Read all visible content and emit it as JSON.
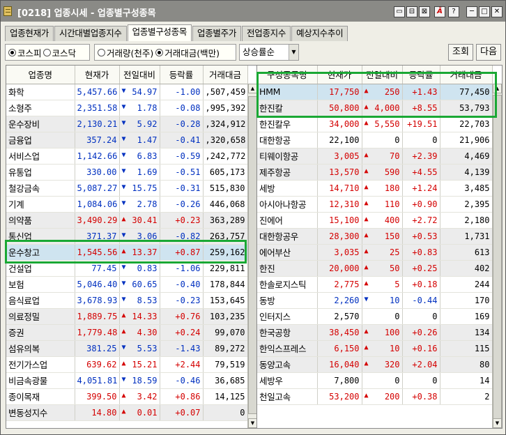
{
  "window": {
    "title": "[0218] 업종시세 - 업종별구성종목",
    "controls": [
      "▭",
      "⊟",
      "⊠",
      "Ā",
      "?",
      "─",
      "□",
      "✕"
    ]
  },
  "tabs": [
    "업종현재가",
    "시간대별업종지수",
    "업종별구성종목",
    "업종별주가",
    "전업종지수",
    "예상지수추이"
  ],
  "active_tab": "업종별구성종목",
  "filters": {
    "market_options": [
      "코스피",
      "코스닥"
    ],
    "market_selected": "코스피",
    "unit_options": [
      "거래량(천주)",
      "거래대금(백만)"
    ],
    "unit_selected": "거래대금(백만)",
    "sort_select": "상승률순",
    "query_button": "조회",
    "next_button": "다음"
  },
  "left_table": {
    "headers": [
      "업종명",
      "현재가",
      "전일대비",
      "등락률",
      "거래대금"
    ],
    "rows": [
      {
        "name": "화학",
        "price": "5,457.66",
        "dir": "down",
        "chg": "54.97",
        "rate": "-1.00",
        "amt": ",507,459"
      },
      {
        "name": "소형주",
        "price": "2,351.58",
        "dir": "down",
        "chg": "1.78",
        "rate": "-0.08",
        "amt": ",995,392"
      },
      {
        "name": "운수장비",
        "price": "2,130.21",
        "dir": "down",
        "chg": "5.92",
        "rate": "-0.28",
        "amt": ",324,912"
      },
      {
        "name": "금융업",
        "price": "357.24",
        "dir": "down",
        "chg": "1.47",
        "rate": "-0.41",
        "amt": ",320,658"
      },
      {
        "name": "서비스업",
        "price": "1,142.66",
        "dir": "down",
        "chg": "6.83",
        "rate": "-0.59",
        "amt": ",242,772"
      },
      {
        "name": "유통업",
        "price": "330.00",
        "dir": "down",
        "chg": "1.69",
        "rate": "-0.51",
        "amt": "605,173"
      },
      {
        "name": "철강금속",
        "price": "5,087.27",
        "dir": "down",
        "chg": "15.75",
        "rate": "-0.31",
        "amt": "515,830"
      },
      {
        "name": "기계",
        "price": "1,084.06",
        "dir": "down",
        "chg": "2.78",
        "rate": "-0.26",
        "amt": "446,068"
      },
      {
        "name": "의약품",
        "price": "3,490.29",
        "dir": "up",
        "chg": "30.41",
        "rate": "+0.23",
        "amt": "363,289"
      },
      {
        "name": "통신업",
        "price": "371.37",
        "dir": "down",
        "chg": "3.06",
        "rate": "-0.82",
        "amt": "263,757"
      },
      {
        "name": "운수창고",
        "price": "1,545.56",
        "dir": "up",
        "chg": "13.37",
        "rate": "+0.87",
        "amt": "259,162"
      },
      {
        "name": "건설업",
        "price": "77.45",
        "dir": "down",
        "chg": "0.83",
        "rate": "-1.06",
        "amt": "229,811"
      },
      {
        "name": "보험",
        "price": "5,046.40",
        "dir": "down",
        "chg": "60.65",
        "rate": "-0.40",
        "amt": "178,844"
      },
      {
        "name": "음식료업",
        "price": "3,678.93",
        "dir": "down",
        "chg": "8.53",
        "rate": "-0.23",
        "amt": "153,645"
      },
      {
        "name": "의료정밀",
        "price": "1,889.75",
        "dir": "up",
        "chg": "14.33",
        "rate": "+0.76",
        "amt": "103,235"
      },
      {
        "name": "증권",
        "price": "1,779.48",
        "dir": "up",
        "chg": "4.30",
        "rate": "+0.24",
        "amt": "99,070"
      },
      {
        "name": "섬유의복",
        "price": "381.25",
        "dir": "down",
        "chg": "5.53",
        "rate": "-1.43",
        "amt": "89,272"
      },
      {
        "name": "전기가스업",
        "price": "639.62",
        "dir": "up",
        "chg": "15.21",
        "rate": "+2.44",
        "amt": "79,519"
      },
      {
        "name": "비금속광물",
        "price": "4,051.81",
        "dir": "down",
        "chg": "18.59",
        "rate": "-0.46",
        "amt": "36,685"
      },
      {
        "name": "종이목재",
        "price": "399.50",
        "dir": "up",
        "chg": "3.42",
        "rate": "+0.86",
        "amt": "14,125"
      },
      {
        "name": "변동성지수",
        "price": "14.80",
        "dir": "up",
        "chg": "0.01",
        "rate": "+0.07",
        "amt": "0"
      }
    ]
  },
  "right_table": {
    "headers": [
      "구성종목명",
      "현재가",
      "전일대비",
      "등락률",
      "거래대금"
    ],
    "rows": [
      {
        "name": "HMM",
        "price": "17,750",
        "dir": "up",
        "chg": "250",
        "rate": "+1.43",
        "amt": "77,450"
      },
      {
        "name": "한진칼",
        "price": "50,800",
        "dir": "up",
        "chg": "4,000",
        "rate": "+8.55",
        "amt": "53,793"
      },
      {
        "name": "한진칼우",
        "price": "34,000",
        "dir": "up",
        "chg": "5,550",
        "rate": "+19.51",
        "amt": "22,703"
      },
      {
        "name": "대한항공",
        "price": "22,100",
        "dir": "flat",
        "chg": "0",
        "rate": "0",
        "amt": "21,906"
      },
      {
        "name": "티웨이항공",
        "price": "3,005",
        "dir": "up",
        "chg": "70",
        "rate": "+2.39",
        "amt": "4,469"
      },
      {
        "name": "제주항공",
        "price": "13,570",
        "dir": "up",
        "chg": "590",
        "rate": "+4.55",
        "amt": "4,139"
      },
      {
        "name": "세방",
        "price": "14,710",
        "dir": "up",
        "chg": "180",
        "rate": "+1.24",
        "amt": "3,485"
      },
      {
        "name": "아시아나항공",
        "price": "12,310",
        "dir": "up",
        "chg": "110",
        "rate": "+0.90",
        "amt": "2,395"
      },
      {
        "name": "진에어",
        "price": "15,100",
        "dir": "up",
        "chg": "400",
        "rate": "+2.72",
        "amt": "2,180"
      },
      {
        "name": "대한항공우",
        "price": "28,300",
        "dir": "up",
        "chg": "150",
        "rate": "+0.53",
        "amt": "1,731"
      },
      {
        "name": "에어부산",
        "price": "3,035",
        "dir": "up",
        "chg": "25",
        "rate": "+0.83",
        "amt": "613"
      },
      {
        "name": "한진",
        "price": "20,000",
        "dir": "up",
        "chg": "50",
        "rate": "+0.25",
        "amt": "402"
      },
      {
        "name": "한솔로지스틱",
        "price": "2,775",
        "dir": "up",
        "chg": "5",
        "rate": "+0.18",
        "amt": "244"
      },
      {
        "name": "동방",
        "price": "2,260",
        "dir": "down",
        "chg": "10",
        "rate": "-0.44",
        "amt": "170"
      },
      {
        "name": "인터지스",
        "price": "2,570",
        "dir": "flat",
        "chg": "0",
        "rate": "0",
        "amt": "169"
      },
      {
        "name": "한국공항",
        "price": "38,450",
        "dir": "up",
        "chg": "100",
        "rate": "+0.26",
        "amt": "134"
      },
      {
        "name": "한익스프레스",
        "price": "6,150",
        "dir": "up",
        "chg": "10",
        "rate": "+0.16",
        "amt": "115"
      },
      {
        "name": "동양고속",
        "price": "16,040",
        "dir": "up",
        "chg": "320",
        "rate": "+2.04",
        "amt": "80"
      },
      {
        "name": "세방우",
        "price": "7,800",
        "dir": "flat",
        "chg": "0",
        "rate": "0",
        "amt": "14"
      },
      {
        "name": "천일고속",
        "price": "53,200",
        "dir": "up",
        "chg": "200",
        "rate": "+0.38",
        "amt": "2"
      }
    ]
  },
  "colors": {
    "up": "#d40000",
    "down": "#0030c0",
    "highlight": "#cfe4f0",
    "annotation": "#1aa834"
  }
}
